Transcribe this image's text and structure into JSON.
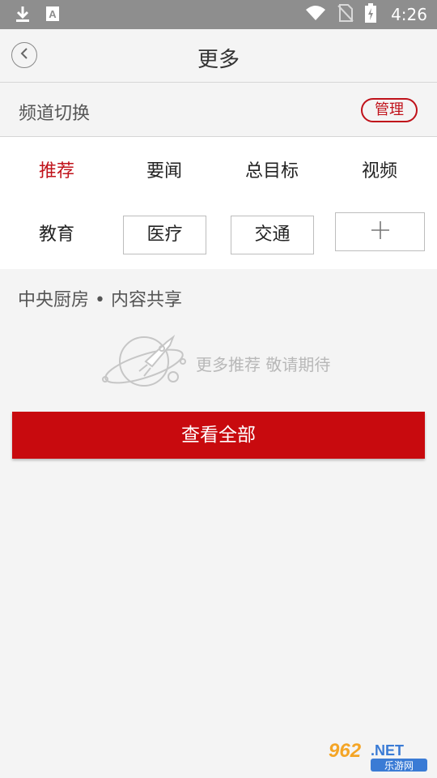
{
  "status_bar": {
    "time": "4:26",
    "left_icons": [
      "download-icon",
      "text-a-icon"
    ],
    "right_icons": [
      "wifi-icon",
      "no-sim-icon",
      "battery-charging-icon"
    ]
  },
  "header": {
    "title": "更多",
    "back_icon": "chevron-left-icon"
  },
  "channel_switch": {
    "label": "频道切换",
    "manage_label": "管理"
  },
  "channels": [
    {
      "label": "推荐",
      "active": true,
      "boxed": false
    },
    {
      "label": "要闻",
      "active": false,
      "boxed": false
    },
    {
      "label": "总目标",
      "active": false,
      "boxed": false
    },
    {
      "label": "视频",
      "active": false,
      "boxed": false
    },
    {
      "label": "教育",
      "active": false,
      "boxed": false
    },
    {
      "label": "医疗",
      "active": false,
      "boxed": true
    },
    {
      "label": "交通",
      "active": false,
      "boxed": true
    }
  ],
  "add_channel_icon": "plus-icon",
  "content_share": {
    "title": "中央厨房 • 内容共享",
    "empty_text": "更多推荐 敬请期待",
    "empty_icon": "rocket-planet-icon"
  },
  "view_all_label": "查看全部",
  "colors": {
    "accent": "#c80a0e",
    "status_bar": "#8e8e8e",
    "background": "#f4f4f4"
  },
  "watermark": {
    "brand": "962.NET",
    "subtitle": "乐游网"
  }
}
